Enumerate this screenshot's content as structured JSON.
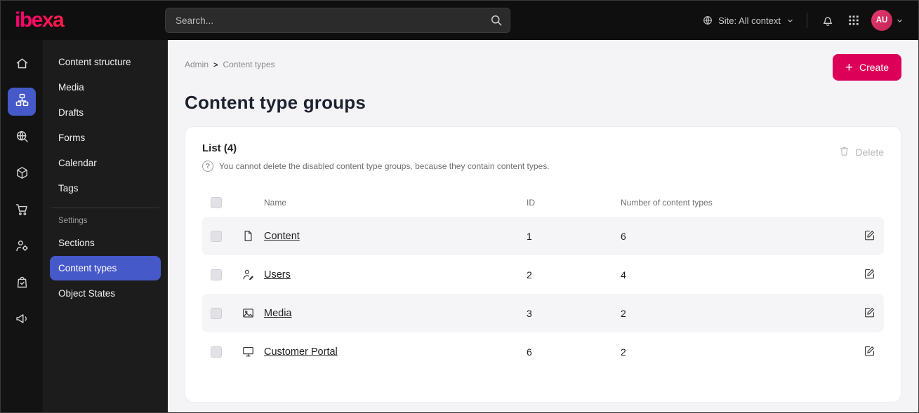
{
  "topbar": {
    "brand": "ibexa",
    "search": {
      "placeholder": "Search..."
    },
    "site_context": "Site: All context",
    "user_avatar": "AU"
  },
  "icon_rail": {
    "items": [
      {
        "icon": "home-icon"
      },
      {
        "icon": "content-tree-icon",
        "active": true
      },
      {
        "icon": "site-search-globe-icon"
      },
      {
        "icon": "product-catalog-icon"
      },
      {
        "icon": "cart-icon"
      },
      {
        "icon": "user-settings-icon"
      },
      {
        "icon": "order-bag-icon"
      },
      {
        "icon": "megaphone-icon"
      }
    ]
  },
  "sidebar": {
    "items": [
      "Content structure",
      "Media",
      "Drafts",
      "Forms",
      "Calendar",
      "Tags"
    ],
    "settings_label": "Settings",
    "settings_items": [
      "Sections",
      "Content types",
      "Object States"
    ],
    "active_item": "Content types"
  },
  "main": {
    "breadcrumb": {
      "parent": "Admin",
      "separator": ">",
      "current": "Content types"
    },
    "create_button": {
      "plus": "+",
      "label": "Create"
    },
    "page_title": "Content type groups",
    "card": {
      "list_title": "List (4)",
      "info_icon": "?",
      "info_text": "You cannot delete the disabled content type groups, because they contain content types.",
      "delete_button": "Delete",
      "table": {
        "headers": {
          "name": "Name",
          "id": "ID",
          "count": "Number of content types"
        },
        "rows": [
          {
            "icon": "content-file-icon",
            "name": "Content",
            "id": "1",
            "count": "6"
          },
          {
            "icon": "users-icon",
            "name": "Users",
            "id": "2",
            "count": "4"
          },
          {
            "icon": "media-image-icon",
            "name": "Media",
            "id": "3",
            "count": "2"
          },
          {
            "icon": "customer-portal-icon",
            "name": "Customer Portal",
            "id": "6",
            "count": "2"
          }
        ]
      }
    }
  },
  "colors": {
    "accent_pink": "#dc0058",
    "active_blue": "#4559c8",
    "topbar_bg": "#0f0f0f",
    "rail_bg": "#131313",
    "sidebar_bg": "#1c1c1c",
    "main_bg": "#f4f4f6",
    "row_alt_bg": "#f5f5f7"
  }
}
